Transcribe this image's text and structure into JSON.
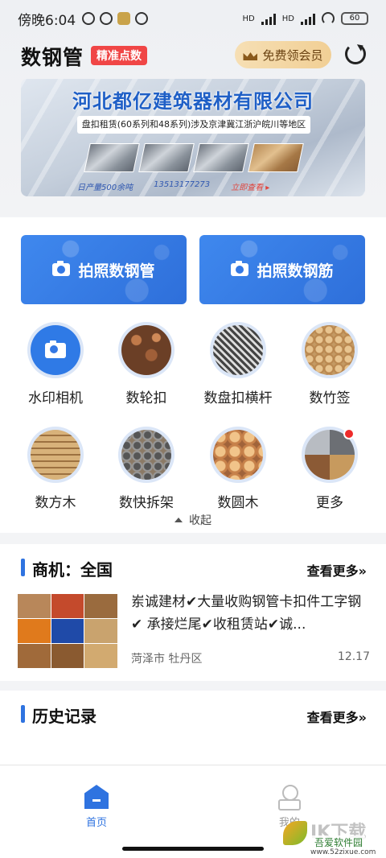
{
  "status": {
    "time": "傍晚6:04",
    "battery": "60",
    "net1": "HD",
    "net2": "HD"
  },
  "header": {
    "title": "数钢管",
    "badge": "精准点数",
    "vip_label": "免费领会员"
  },
  "banner": {
    "company": "河北都亿建筑器材有限公司",
    "subtitle": "盘扣租赁(60系列和48系列)涉及京津冀江浙沪皖川等地区",
    "capacity": "日产量500余吨",
    "phone": "13513177273",
    "view": "立即查看 ▸"
  },
  "actions": {
    "pipe": "拍照数钢管",
    "rebar": "拍照数钢筋"
  },
  "grid": [
    {
      "label": "水印相机",
      "icon": "camera-icon"
    },
    {
      "label": "数轮扣",
      "icon": "wheel-buckle-photo"
    },
    {
      "label": "数盘扣横杆",
      "icon": "disc-buckle-photo"
    },
    {
      "label": "数竹签",
      "icon": "bamboo-stick-photo"
    },
    {
      "label": "数方木",
      "icon": "square-timber-photo"
    },
    {
      "label": "数快拆架",
      "icon": "quick-frame-photo"
    },
    {
      "label": "数圆木",
      "icon": "round-log-photo"
    },
    {
      "label": "更多",
      "icon": "more-photo"
    }
  ],
  "collapse_label": "收起",
  "business": {
    "title": "商机：全国",
    "more": "查看更多»",
    "item": {
      "text": "岽诚建材✔大量收购钢管卡扣件工字钢✔ 承接烂尾✔收租赁站✔诚...",
      "location": "菏泽市 牡丹区",
      "date": "12.17"
    }
  },
  "history": {
    "title": "历史记录",
    "more": "查看更多»"
  },
  "tabs": {
    "home": "首页",
    "me": "我的"
  },
  "watermark": {
    "t1": "IK下载",
    "t2": "吾爱软件园",
    "t3": "www.52zixue.com"
  },
  "colors": {
    "primary": "#2f73e0",
    "badge": "#f04646",
    "vip": "#f1cf95"
  }
}
